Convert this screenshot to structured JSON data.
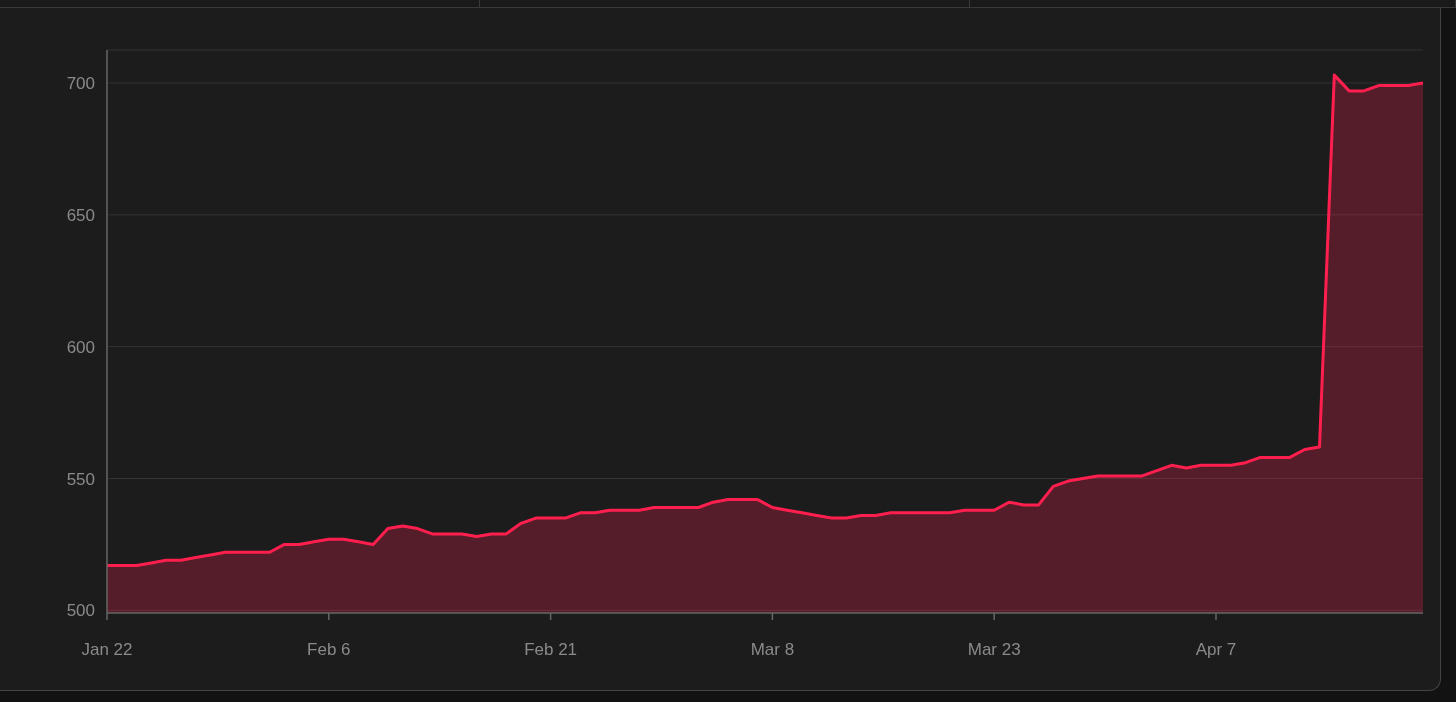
{
  "chart": {
    "chart_data": {
      "type": "area",
      "grid": true,
      "categories": [
        "Jan 22",
        null,
        null,
        null,
        null,
        null,
        null,
        null,
        null,
        null,
        null,
        null,
        null,
        null,
        null,
        "Feb 6",
        null,
        null,
        null,
        null,
        null,
        null,
        null,
        null,
        null,
        null,
        null,
        null,
        null,
        null,
        "Feb 21",
        null,
        null,
        null,
        null,
        null,
        null,
        null,
        null,
        null,
        null,
        null,
        null,
        null,
        null,
        "Mar 8",
        null,
        null,
        null,
        null,
        null,
        null,
        null,
        null,
        null,
        null,
        null,
        null,
        null,
        null,
        "Mar 23",
        null,
        null,
        null,
        null,
        null,
        null,
        null,
        null,
        null,
        null,
        null,
        null,
        null,
        null,
        "Apr 7",
        null,
        null,
        null,
        null,
        null,
        null,
        null,
        null,
        null,
        null,
        null,
        null,
        null,
        null
      ],
      "series": [
        {
          "color": "#ff1f4f",
          "values": [
            517,
            517,
            517,
            518,
            519,
            519,
            520,
            521,
            522,
            522,
            522,
            522,
            525,
            525,
            526,
            527,
            527,
            526,
            525,
            531,
            532,
            531,
            529,
            529,
            529,
            528,
            529,
            529,
            533,
            535,
            535,
            535,
            537,
            537,
            538,
            538,
            538,
            539,
            539,
            539,
            539,
            541,
            542,
            542,
            542,
            539,
            538,
            537,
            536,
            535,
            535,
            536,
            536,
            537,
            537,
            537,
            537,
            537,
            538,
            538,
            538,
            541,
            540,
            540,
            547,
            549,
            550,
            551,
            551,
            551,
            551,
            553,
            555,
            554,
            555,
            555,
            555,
            556,
            558,
            558,
            558,
            561,
            562,
            703,
            697,
            697,
            699,
            699,
            699,
            700
          ]
        }
      ],
      "ylim": [
        499,
        712.5
      ],
      "yticks": [
        500,
        550,
        600,
        650,
        700
      ]
    }
  }
}
